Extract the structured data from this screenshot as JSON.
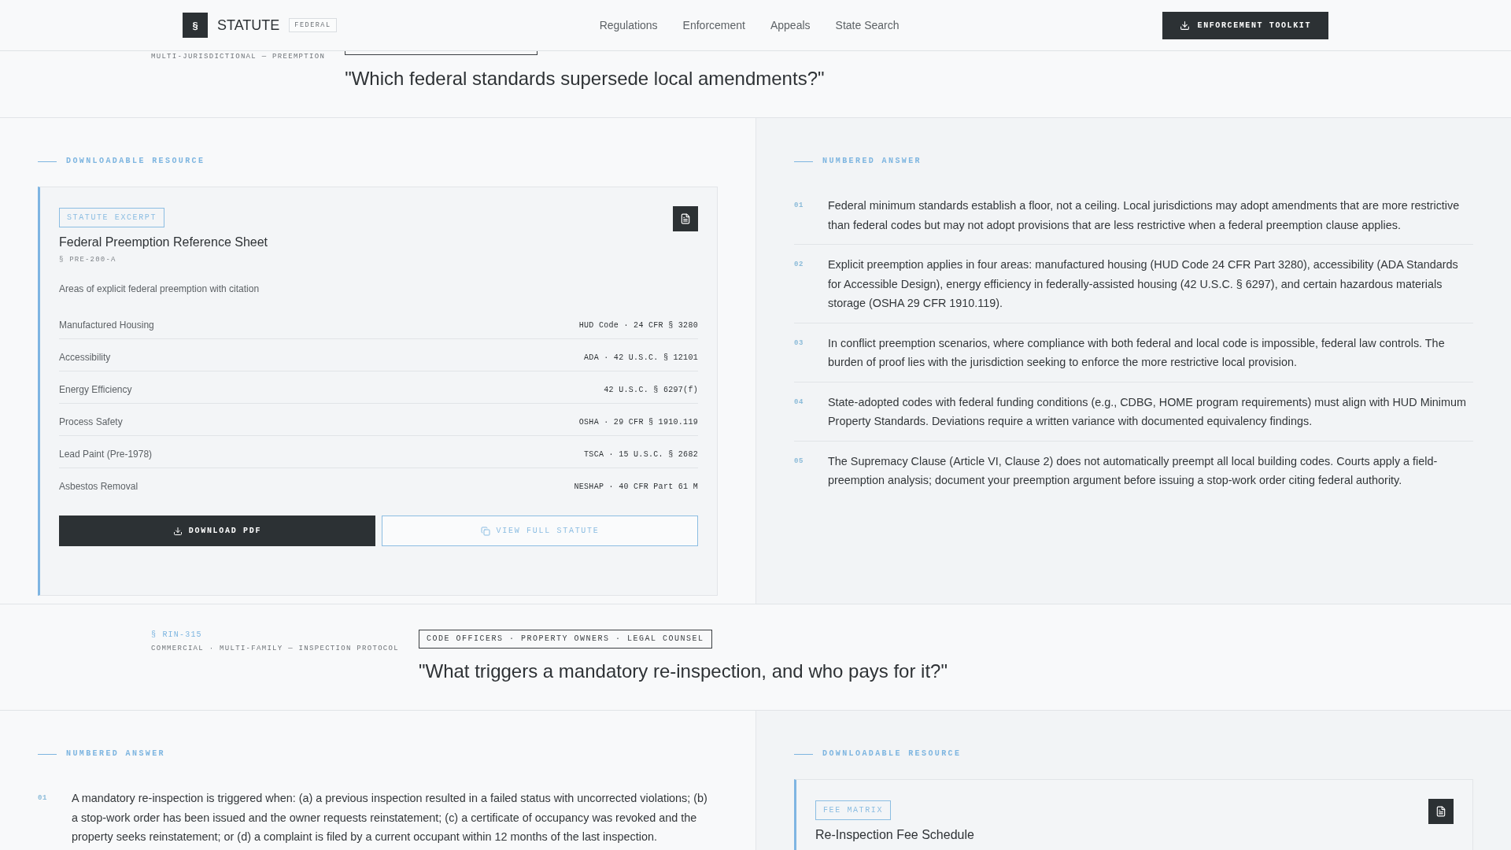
{
  "header": {
    "brand": {
      "mark": "§",
      "name": "STATUTE",
      "badge": "FEDERAL"
    },
    "nav": [
      {
        "label": "Regulations"
      },
      {
        "label": "Enforcement"
      },
      {
        "label": "Appeals"
      },
      {
        "label": "State Search"
      }
    ],
    "action": {
      "label": "ENFORCEMENT TOOLKIT"
    }
  },
  "entries": [
    {
      "band": {
        "kind": "partial",
        "meta": "MULTI-JURISDICTIONAL — PREEMPTION",
        "question": "\"Which federal standards supersede local amendments?\""
      },
      "panels": [
        {
          "kind": "resource",
          "heading": "DOWNLOADABLE RESOURCE",
          "badge": "STATUTE EXCERPT",
          "title": "Federal Preemption Reference Sheet",
          "ref": "§ PRE-200-A",
          "description": "Areas of explicit federal preemption with citation",
          "rows": [
            {
              "label": "Manufactured Housing",
              "value": "HUD Code · 24 CFR § 3280"
            },
            {
              "label": "Accessibility",
              "value": "ADA · 42 U.S.C. § 12101"
            },
            {
              "label": "Energy Efficiency",
              "value": "42 U.S.C. § 6297(f)"
            },
            {
              "label": "Process Safety",
              "value": "OSHA · 29 CFR § 1910.119"
            },
            {
              "label": "Lead Paint (Pre-1978)",
              "value": "TSCA · 15 U.S.C. § 2682"
            },
            {
              "label": "Asbestos Removal",
              "value": "NESHAP · 40 CFR Part 61 M"
            }
          ],
          "buttons": [
            {
              "kind": "primary",
              "label": "DOWNLOAD PDF"
            },
            {
              "kind": "secondary",
              "label": "VIEW FULL STATUTE"
            }
          ]
        },
        {
          "kind": "answers",
          "heading": "NUMBERED ANSWER",
          "items": [
            {
              "number": "01",
              "text": "Federal minimum standards establish a floor, not a ceiling. Local jurisdictions may adopt amendments that are more restrictive than federal codes but may not adopt provisions that are less restrictive when a federal preemption clause applies."
            },
            {
              "number": "02",
              "text": "Explicit preemption applies in four areas: manufactured housing (HUD Code 24 CFR Part 3280), accessibility (ADA Standards for Accessible Design), energy efficiency in federally-assisted housing (42 U.S.C. § 6297), and certain hazardous materials storage (OSHA 29 CFR 1910.119)."
            },
            {
              "number": "03",
              "text": "In conflict preemption scenarios, where compliance with both federal and local code is impossible, federal law controls. The burden of proof lies with the jurisdiction seeking to enforce the more restrictive local provision."
            },
            {
              "number": "04",
              "text": "State-adopted codes with federal funding conditions (e.g., CDBG, HOME program requirements) must align with HUD Minimum Property Standards. Deviations require a written variance with documented equivalency findings."
            },
            {
              "number": "05",
              "text": "The Supremacy Clause (Article VI, Clause 2) does not automatically preempt all local building codes. Courts apply a field-preemption analysis; document your preemption argument before issuing a stop-work order citing federal authority."
            }
          ]
        }
      ]
    },
    {
      "band": {
        "kind": "full",
        "ref": "§ RIN-315",
        "meta": "COMMERCIAL · MULTI-FAMILY — INSPECTION PROTOCOL",
        "audience": "CODE OFFICERS · PROPERTY OWNERS · LEGAL COUNSEL",
        "question": "\"What triggers a mandatory re-inspection, and who pays for it?\""
      },
      "panels": [
        {
          "kind": "answers",
          "heading": "NUMBERED ANSWER",
          "items": [
            {
              "number": "01",
              "text": "A mandatory re-inspection is triggered when: (a) a previous inspection resulted in a failed status with uncorrected violations; (b) a stop-work order has been issued and the owner requests reinstatement; (c) a certificate of occupancy was revoked and the property seeks reinstatement; or (d) a complaint is filed by a current occupant within 12 months of the last inspection."
            }
          ]
        },
        {
          "kind": "resource",
          "heading": "DOWNLOADABLE RESOURCE",
          "badge": "FEE MATRIX",
          "title": "Re-Inspection Fee Schedule"
        }
      ]
    }
  ]
}
